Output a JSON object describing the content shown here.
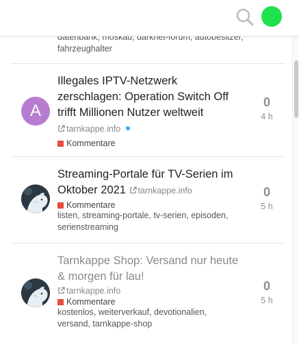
{
  "header": {
    "search_icon": "search-icon",
    "avatar_color": "#1ee14b"
  },
  "cutoff_tags": "datenbank, moskau, darknet-forum, autobesitzer, fahrzeughalter",
  "topics": [
    {
      "avatar_letter": "A",
      "title": "Illegales IPTV-Netzwerk zerschlagen: Operation Switch Off trifft Millionen Nutzer weltweit",
      "domain": "tarnkappe.info",
      "category": "Kommentare",
      "tags": "",
      "count": "0",
      "ago": "4 h"
    },
    {
      "avatar_letter": "",
      "title": "Streaming-Portale für TV-Serien im Oktober 2021",
      "domain": "tarnkappe.info",
      "category": "Kommentare",
      "tags": "listen, streaming-portale, tv-serien, episoden, serienstreaming",
      "count": "0",
      "ago": "5 h"
    },
    {
      "avatar_letter": "",
      "title": "Tarnkappe Shop: Versand nur heute & morgen für lau!",
      "domain": "tarnkappe.info",
      "category": "Kommentare",
      "tags": "kostenlos, weiterverkauf, devotionalien, versand, tarnkappe-shop",
      "count": "0",
      "ago": "5 h"
    }
  ],
  "colors": {
    "category": "#e74c3c",
    "unread_dot": "#3aaaf0",
    "letter_avatar": "#b67ccf"
  }
}
